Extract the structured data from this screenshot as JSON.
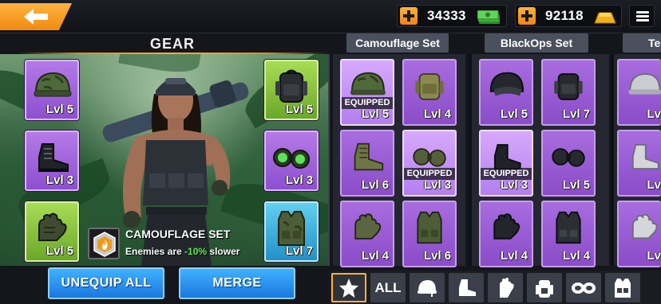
{
  "header": {
    "back_icon": "back-arrow-icon",
    "cash": {
      "amount": "34333",
      "icon": "cash-stack-icon",
      "add_icon": "plus-icon"
    },
    "gold": {
      "amount": "92118",
      "icon": "gold-bar-icon",
      "add_icon": "plus-icon"
    },
    "menu_icon": "hamburger-menu-icon"
  },
  "gear": {
    "title": "GEAR",
    "left_slots": [
      {
        "item": "helmet",
        "level": "Lvl 5",
        "rarity": "purple"
      },
      {
        "item": "boots",
        "level": "Lvl 3",
        "rarity": "purple"
      },
      {
        "item": "gloves",
        "level": "Lvl 5",
        "rarity": "green"
      }
    ],
    "right_slots": [
      {
        "item": "backpack",
        "level": "Lvl 5",
        "rarity": "green"
      },
      {
        "item": "goggles",
        "level": "Lvl 3",
        "rarity": "purple"
      },
      {
        "item": "vest",
        "level": "Lvl 7",
        "rarity": "cyan"
      }
    ],
    "set_bonus": {
      "icon": "flame-hexagon-icon",
      "name": "CAMOUFLAGE SET",
      "desc_prefix": "Enemies are ",
      "desc_value": "-10%",
      "desc_suffix": " slower"
    },
    "buttons": {
      "unequip_all": "UNEQUIP ALL",
      "merge": "MERGE"
    }
  },
  "sets": [
    {
      "name": "Camouflage Set",
      "items": [
        {
          "item": "helmet",
          "level": "Lvl 5",
          "equipped": "EQUIPPED"
        },
        {
          "item": "backpack",
          "level": "Lvl 4",
          "equipped": ""
        },
        {
          "item": "boots",
          "level": "Lvl 6",
          "equipped": ""
        },
        {
          "item": "goggles",
          "level": "Lvl 3",
          "equipped": "EQUIPPED"
        },
        {
          "item": "gloves",
          "level": "Lvl 4",
          "equipped": ""
        },
        {
          "item": "vest",
          "level": "Lvl 6",
          "equipped": ""
        }
      ]
    },
    {
      "name": "BlackOps Set",
      "items": [
        {
          "item": "helmet",
          "level": "Lvl 5",
          "equipped": ""
        },
        {
          "item": "backpack",
          "level": "Lvl 7",
          "equipped": ""
        },
        {
          "item": "boots",
          "level": "Lvl 3",
          "equipped": "EQUIPPED"
        },
        {
          "item": "goggles",
          "level": "Lvl 5",
          "equipped": ""
        },
        {
          "item": "gloves",
          "level": "Lvl 4",
          "equipped": ""
        },
        {
          "item": "vest",
          "level": "Lvl 4",
          "equipped": ""
        }
      ]
    },
    {
      "name": "Te",
      "items": [
        {
          "item": "helmet",
          "level": "Lvl",
          "equipped": ""
        },
        {
          "item": "boots",
          "level": "Lvl",
          "equipped": ""
        },
        {
          "item": "gloves",
          "level": "Lvl",
          "equipped": ""
        }
      ]
    }
  ],
  "filters": [
    {
      "icon": "star-icon",
      "active": true
    },
    {
      "label": "ALL"
    },
    {
      "icon": "helmet-icon"
    },
    {
      "icon": "boot-icon"
    },
    {
      "icon": "glove-icon"
    },
    {
      "icon": "backpack-icon"
    },
    {
      "icon": "goggles-icon"
    },
    {
      "icon": "vest-icon"
    }
  ]
}
